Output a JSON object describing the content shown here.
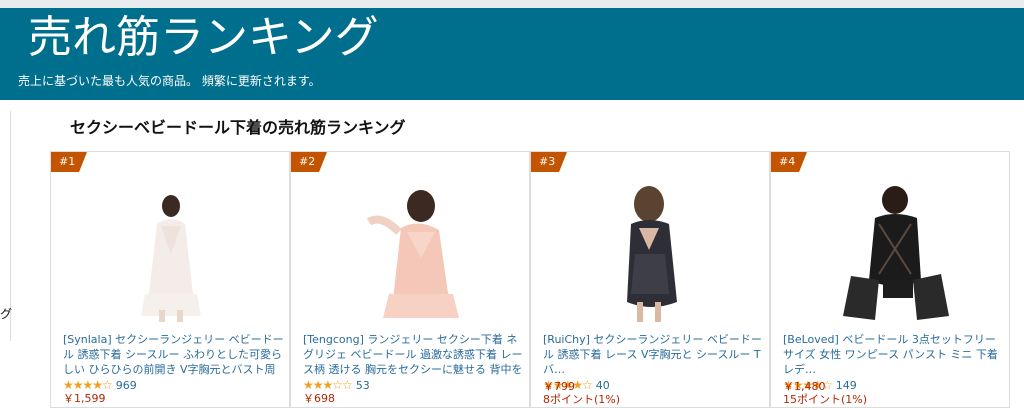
{
  "banner": {
    "title": "、売れ筋ランキング",
    "subtitle": "売上に基づいた最も人気の商品。 頻繁に更新されます。"
  },
  "sidebar": {
    "fragment": "グ"
  },
  "section": {
    "title": "セクシーベビードール下着の売れ筋ランキング"
  },
  "products": [
    {
      "rank": "#1",
      "title": "[Synlala] セクシーランジェリー ベビードール 誘惑下着 シースルー ふわりとした可愛らしい ひらひらの前開き V字胸元とバスト周りの透…",
      "stars": "★★★★☆",
      "reviews": "969",
      "price": "￥1,599",
      "points": ""
    },
    {
      "rank": "#2",
      "title": "[Tengcong] ランジェリー セクシー下着 ネグリジェ ベビードール 過激な誘惑下着 レース柄 透ける 胸元をセクシーに魅せる 背中を可愛…",
      "stars": "★★★☆☆",
      "reviews": "53",
      "price": "￥698",
      "points": ""
    },
    {
      "rank": "#3",
      "title": "[RuiChy] セクシーランジェリー ベビードール 誘惑下着 レース V字胸元と シースルー Tバ…",
      "stars": "★★★★☆",
      "reviews": "40",
      "price": "￥799",
      "points": "8ポイント(1%)"
    },
    {
      "rank": "#4",
      "title": "[BeLoved] ベビードール 3点セットフリーサイズ 女性 ワンピース パンスト ミニ 下着 レデ…",
      "stars": "★★★★☆",
      "reviews": "149",
      "price": "￥1,480",
      "points": "15ポイント(1%)"
    }
  ],
  "colors": {
    "banner": "#006f8e",
    "rank_badge": "#c45500",
    "link": "#2a6c9a",
    "price": "#b12704",
    "star": "#f0a020"
  }
}
